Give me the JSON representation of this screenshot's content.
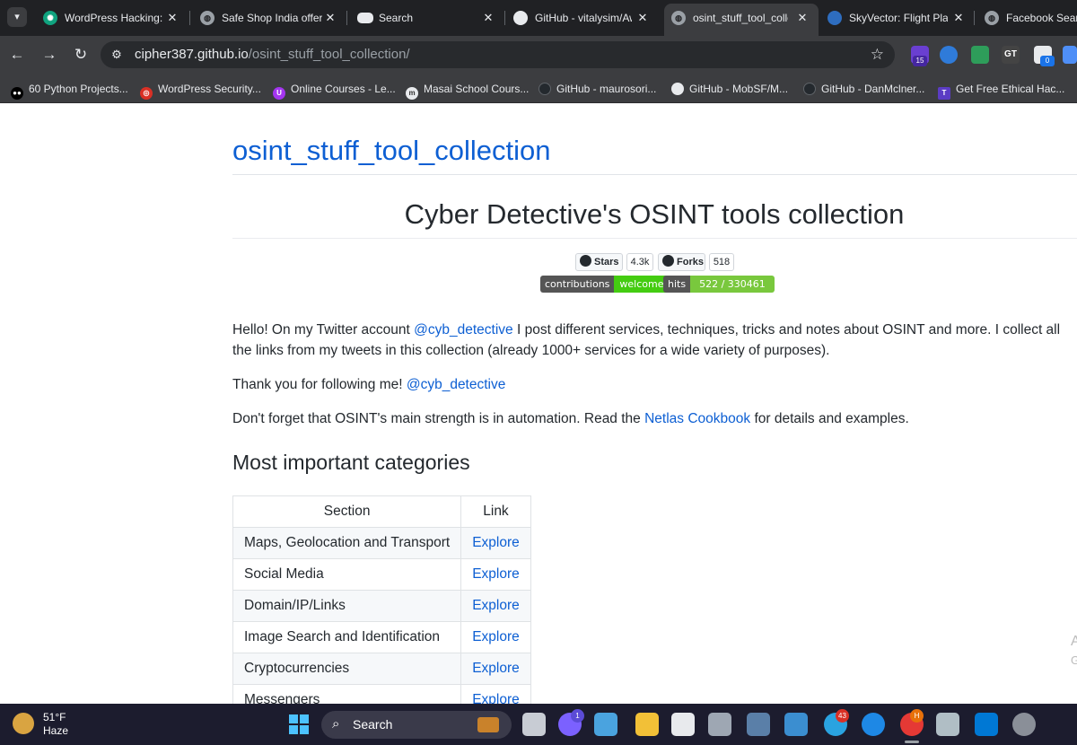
{
  "tabs": [
    {
      "title": "WordPress Hacking: I",
      "icon": "chatgpt-icon"
    },
    {
      "title": "Safe Shop India offer",
      "icon": "globe-icon"
    },
    {
      "title": "Search",
      "icon": "search-site-icon"
    },
    {
      "title": "GitHub - vitalysim/Aw",
      "icon": "github-icon"
    },
    {
      "title": "osint_stuff_tool_colle",
      "icon": "globe-icon",
      "active": true
    },
    {
      "title": "SkyVector: Flight Plan",
      "icon": "skyvector-icon"
    },
    {
      "title": "Facebook Search",
      "icon": "globe-icon"
    }
  ],
  "tab_close_glyph": "✕",
  "address": {
    "host": "cipher387.github.io",
    "path": "/osint_stuff_tool_collection/"
  },
  "extensions": [
    {
      "name": "extension-purple-icon",
      "badge": "15",
      "color": "#6a3fd1"
    },
    {
      "name": "extension-ninja-icon"
    },
    {
      "name": "extension-download-icon"
    },
    {
      "name": "extension-gt-icon",
      "label": "GT"
    },
    {
      "name": "extension-notepad-icon",
      "badge": "0"
    },
    {
      "name": "extension-blue-icon"
    }
  ],
  "bookmarks": [
    {
      "label": "60 Python Projects...",
      "icon": "medium-icon",
      "color": "#000000"
    },
    {
      "label": "WordPress Security...",
      "icon": "target-icon",
      "color": "#d93025"
    },
    {
      "label": "Online Courses - Le...",
      "icon": "udemy-icon",
      "color": "#a435f0"
    },
    {
      "label": "Masai School Cours...",
      "icon": "masai-icon",
      "color": "#333333"
    },
    {
      "label": "GitHub - maurosori...",
      "icon": "github-icon",
      "color": "#24292e"
    },
    {
      "label": "GitHub - MobSF/M...",
      "icon": "github-icon",
      "color": "#24292e"
    },
    {
      "label": "GitHub - DanMclner...",
      "icon": "github-icon",
      "color": "#24292e"
    },
    {
      "label": "Get Free Ethical Hac...",
      "icon": "tutorial-icon",
      "color": "#5b3cc4"
    }
  ],
  "page": {
    "site_title": "osint_stuff_tool_collection",
    "heading": "Cyber Detective's OSINT tools collection",
    "badges": {
      "stars_label": "Stars",
      "stars_count": "4.3k",
      "forks_label": "Forks",
      "forks_count": "518",
      "contrib_left": "contributions",
      "contrib_right": "welcome",
      "hits_left": "hits",
      "hits_right": "522 / 330461"
    },
    "para1": {
      "before": "Hello! On my Twitter account ",
      "link": "@cyb_detective",
      "after": " I post different services, techniques, tricks and notes about OSINT and more. I collect all the links from my tweets in this collection (already 1000+ services for a wide variety of purposes)."
    },
    "para2": {
      "before": "Thank you for following me! ",
      "link": "@cyb_detective"
    },
    "para3": {
      "before": "Don't forget that OSINT's main strength is in automation. Read the ",
      "link": "Netlas Cookbook",
      "after": " for details and examples."
    },
    "section_heading": "Most important categories",
    "table": {
      "headers": [
        "Section",
        "Link"
      ],
      "rows": [
        [
          "Maps, Geolocation and Transport",
          "Explore"
        ],
        [
          "Social Media",
          "Explore"
        ],
        [
          "Domain/IP/Links",
          "Explore"
        ],
        [
          "Image Search and Identification",
          "Explore"
        ],
        [
          "Cryptocurrencies",
          "Explore"
        ],
        [
          "Messengers",
          "Explore"
        ]
      ]
    },
    "edge_glyphs": [
      "A",
      "G"
    ]
  },
  "taskbar": {
    "temperature": "51°F",
    "condition": "Haze",
    "search_label": "Search",
    "chat_badge": "1",
    "teams_badge": "43",
    "chrome_badge": "H"
  },
  "colors": {
    "link": "#0d5fd3",
    "contrib_right": "#4c1",
    "hits_right": "#79c83d",
    "chrome_dark": "#202124",
    "taskbar": "#1c1c2e"
  }
}
